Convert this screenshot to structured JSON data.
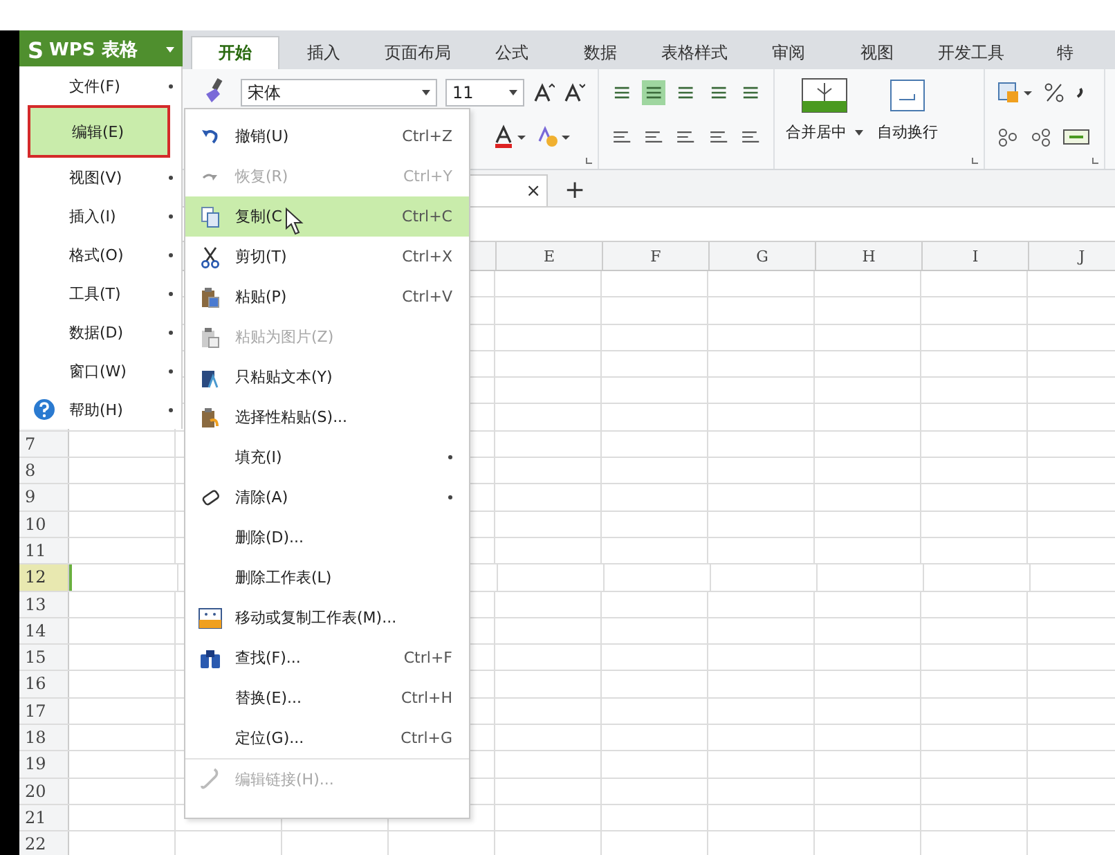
{
  "app_button": {
    "logo": "S",
    "label": "WPS 表格"
  },
  "tabs": [
    {
      "label": "开始",
      "selected": true
    },
    {
      "label": "插入",
      "selected": false
    },
    {
      "label": "页面布局",
      "selected": false
    },
    {
      "label": "公式",
      "selected": false
    },
    {
      "label": "数据",
      "selected": false
    },
    {
      "label": "表格样式",
      "selected": false
    },
    {
      "label": "审阅",
      "selected": false
    },
    {
      "label": "视图",
      "selected": false
    },
    {
      "label": "开发工具",
      "selected": false
    },
    {
      "label": "特",
      "selected": false
    }
  ],
  "ribbon": {
    "font_name": "宋体",
    "font_size": "11",
    "merge_label": "合并居中",
    "wrap_label": "自动换行"
  },
  "sheet_tabs": {
    "close": "×",
    "add": "+"
  },
  "columns": [
    "E",
    "F",
    "G",
    "H",
    "I",
    "J"
  ],
  "rows": [
    {
      "label": "7",
      "selected": false
    },
    {
      "label": "8",
      "selected": false
    },
    {
      "label": "9",
      "selected": false
    },
    {
      "label": "10",
      "selected": false
    },
    {
      "label": "11",
      "selected": false
    },
    {
      "label": "12",
      "selected": true
    },
    {
      "label": "13",
      "selected": false
    },
    {
      "label": "14",
      "selected": false
    },
    {
      "label": "15",
      "selected": false
    },
    {
      "label": "16",
      "selected": false
    },
    {
      "label": "17",
      "selected": false
    },
    {
      "label": "18",
      "selected": false
    },
    {
      "label": "19",
      "selected": false
    },
    {
      "label": "20",
      "selected": false
    },
    {
      "label": "21",
      "selected": false
    },
    {
      "label": "22",
      "selected": false
    }
  ],
  "main_menu": [
    {
      "label": "文件(F)",
      "selected": false,
      "submenu": true
    },
    {
      "label": "编辑(E)",
      "selected": true,
      "submenu": false
    },
    {
      "label": "视图(V)",
      "selected": false,
      "submenu": true
    },
    {
      "label": "插入(I)",
      "selected": false,
      "submenu": true
    },
    {
      "label": "格式(O)",
      "selected": false,
      "submenu": true
    },
    {
      "label": "工具(T)",
      "selected": false,
      "submenu": true
    },
    {
      "label": "数据(D)",
      "selected": false,
      "submenu": true
    },
    {
      "label": "窗口(W)",
      "selected": false,
      "submenu": true
    },
    {
      "label": "帮助(H)",
      "selected": false,
      "submenu": true
    }
  ],
  "edit_menu": [
    {
      "label": "撤销(U)",
      "shortcut": "Ctrl+Z",
      "selected": false,
      "disabled": false,
      "submenu": false,
      "separator_before": false
    },
    {
      "label": "恢复(R)",
      "shortcut": "Ctrl+Y",
      "selected": false,
      "disabled": true,
      "submenu": false,
      "separator_before": false
    },
    {
      "label": "复制(C",
      "shortcut": "Ctrl+C",
      "selected": true,
      "disabled": false,
      "submenu": false,
      "separator_before": false
    },
    {
      "label": "剪切(T)",
      "shortcut": "Ctrl+X",
      "selected": false,
      "disabled": false,
      "submenu": false,
      "separator_before": false
    },
    {
      "label": "粘贴(P)",
      "shortcut": "Ctrl+V",
      "selected": false,
      "disabled": false,
      "submenu": false,
      "separator_before": false
    },
    {
      "label": "粘贴为图片(Z)",
      "selected": false,
      "disabled": true,
      "submenu": false,
      "separator_before": false
    },
    {
      "label": "只粘贴文本(Y)",
      "selected": false,
      "disabled": false,
      "submenu": false,
      "separator_before": false
    },
    {
      "label": "选择性粘贴(S)...",
      "selected": false,
      "disabled": false,
      "submenu": false,
      "separator_before": false
    },
    {
      "label": "填充(I)",
      "selected": false,
      "disabled": false,
      "submenu": true,
      "separator_before": false
    },
    {
      "label": "清除(A)",
      "selected": false,
      "disabled": false,
      "submenu": true,
      "separator_before": false
    },
    {
      "label": "删除(D)...",
      "selected": false,
      "disabled": false,
      "submenu": false,
      "separator_before": false
    },
    {
      "label": "删除工作表(L)",
      "selected": false,
      "disabled": false,
      "submenu": false,
      "separator_before": false
    },
    {
      "label": "移动或复制工作表(M)...",
      "selected": false,
      "disabled": false,
      "submenu": false,
      "separator_before": false
    },
    {
      "label": "查找(F)...",
      "shortcut": "Ctrl+F",
      "selected": false,
      "disabled": false,
      "submenu": false,
      "separator_before": false
    },
    {
      "label": "替换(E)...",
      "shortcut": "Ctrl+H",
      "selected": false,
      "disabled": false,
      "submenu": false,
      "separator_before": false
    },
    {
      "label": "定位(G)...",
      "shortcut": "Ctrl+G",
      "selected": false,
      "disabled": false,
      "submenu": false,
      "separator_before": false
    },
    {
      "label": "编辑链接(H)...",
      "selected": false,
      "disabled": true,
      "submenu": false,
      "separator_before": true
    }
  ]
}
